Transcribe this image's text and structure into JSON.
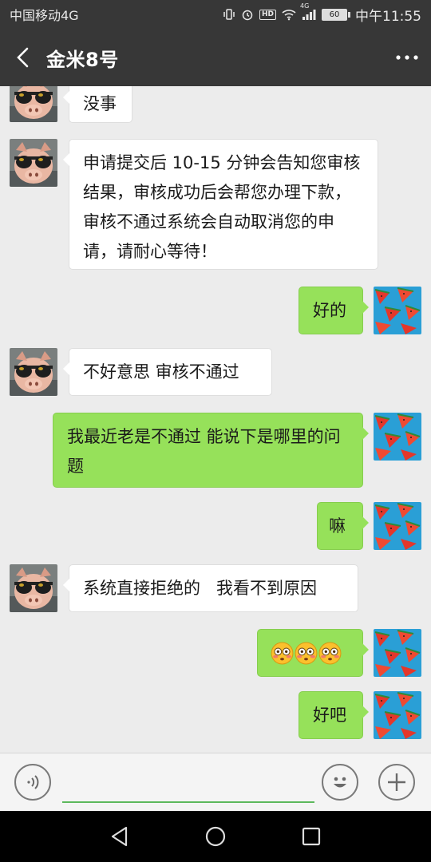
{
  "status_bar": {
    "carrier": "中国移动4G",
    "hd_badge": "HD",
    "network_badge": "4G",
    "battery": "60",
    "time": "中午11:55"
  },
  "header": {
    "title": "金米8号"
  },
  "messages": [
    {
      "from": "other",
      "text": "没事"
    },
    {
      "from": "other",
      "text": "申请提交后 10-15 分钟会告知您审核结果，审核成功后会帮您办理下款，审核不通过系统会自动取消您的申请，请耐心等待！"
    },
    {
      "from": "me",
      "text": "好的"
    },
    {
      "from": "other",
      "text": "不好意思 审核不通过"
    },
    {
      "from": "me",
      "text": "我最近老是不通过 能说下是哪里的问题"
    },
    {
      "from": "me",
      "text": "嘛"
    },
    {
      "from": "other",
      "text": "系统直接拒绝的   我看不到原因"
    },
    {
      "from": "me",
      "emoji": [
        "flushed-face",
        "flushed-face",
        "flushed-face"
      ]
    },
    {
      "from": "me",
      "text": "好吧"
    }
  ],
  "input": {
    "value": "",
    "placeholder": ""
  },
  "colors": {
    "header_bg": "#373737",
    "incoming_bubble": "#ffffff",
    "outgoing_bubble": "#96e15a",
    "chat_bg": "#ececec",
    "input_underline": "#5cb85c"
  },
  "icons": {
    "back": "back-arrow-icon",
    "more": "more-dots-icon",
    "voice": "voice-icon",
    "emoji": "emoji-icon",
    "add": "plus-icon",
    "nav_back": "nav-back-icon",
    "nav_home": "nav-home-icon",
    "nav_recent": "nav-recent-icon"
  }
}
